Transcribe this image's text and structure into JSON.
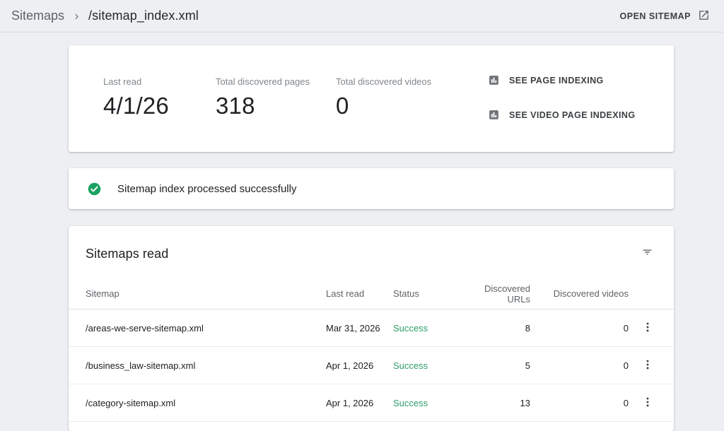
{
  "header": {
    "breadcrumb": {
      "root": "Sitemaps",
      "separator_icon": "chevron-right-icon",
      "current": "/sitemap_index.xml"
    },
    "open_sitemap": {
      "label": "OPEN SITEMAP",
      "icon": "open-in-new-icon"
    }
  },
  "summary": {
    "stats": [
      {
        "label": "Last read",
        "value": "4/1/26"
      },
      {
        "label": "Total discovered pages",
        "value": "318"
      },
      {
        "label": "Total discovered videos",
        "value": "0"
      }
    ],
    "actions": [
      {
        "label": "SEE PAGE INDEXING",
        "icon": "bar-chart-icon"
      },
      {
        "label": "SEE VIDEO PAGE INDEXING",
        "icon": "bar-chart-icon"
      }
    ]
  },
  "banner": {
    "icon": "check-circle-icon",
    "message": "Sitemap index processed successfully"
  },
  "table": {
    "title": "Sitemaps read",
    "filter_icon": "filter-icon",
    "row_menu_icon": "kebab-menu-icon",
    "columns": [
      "Sitemap",
      "Last read",
      "Status",
      "Discovered URLs",
      "Discovered videos"
    ],
    "rows": [
      {
        "sitemap": "/areas-we-serve-sitemap.xml",
        "last_read": "Mar 31, 2026",
        "status": "Success",
        "discovered_urls": "8",
        "discovered_videos": "0"
      },
      {
        "sitemap": "/business_law-sitemap.xml",
        "last_read": "Apr 1, 2026",
        "status": "Success",
        "discovered_urls": "5",
        "discovered_videos": "0"
      },
      {
        "sitemap": "/category-sitemap.xml",
        "last_read": "Apr 1, 2026",
        "status": "Success",
        "discovered_urls": "13",
        "discovered_videos": "0"
      }
    ]
  },
  "colors": {
    "page-bg": "#edeff3",
    "card-bg": "#ffffff",
    "text-primary": "#202124",
    "text-secondary": "#5f6368",
    "label-gray": "#80868b",
    "success-green": "#2d9e69",
    "success-icon-green": "#1aa260",
    "divider": "#e0e3e8",
    "icon-gray": "#6e7276"
  }
}
